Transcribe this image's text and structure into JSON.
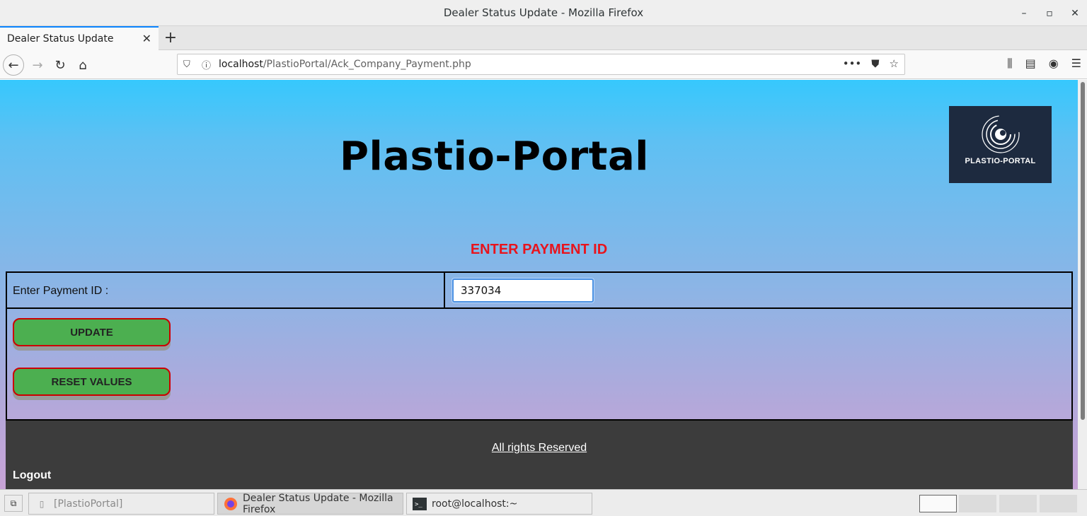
{
  "window": {
    "title": "Dealer Status Update - Mozilla Firefox",
    "minimize": "–",
    "maximize": "▫",
    "close": "✕"
  },
  "tabs": [
    {
      "label": "Dealer Status Update"
    }
  ],
  "nav": {
    "url_host": "localhost",
    "url_path": "/PlastioPortal/Ack_Company_Payment.php"
  },
  "page": {
    "site_title": "Plastio-Portal",
    "logo_text": "PLASTIO-PORTAL",
    "section_heading": "ENTER PAYMENT ID",
    "form": {
      "payment_label": "Enter Payment ID :",
      "payment_value": "337034",
      "update_label": "UPDATE",
      "reset_label": "RESET VALUES"
    },
    "footer": {
      "rights": "All rights Reserved",
      "logout": "Logout"
    }
  },
  "taskbar": {
    "items": [
      {
        "label": "[PlastioPortal]"
      },
      {
        "label": "Dealer Status Update - Mozilla Firefox"
      },
      {
        "label": "root@localhost:~"
      }
    ]
  },
  "colors": {
    "heading_red": "#e8141d",
    "button_green": "#4caf50",
    "button_border": "#cc0000",
    "footer_bg": "#3c3c3c",
    "logo_bg": "#1d2a3f"
  }
}
